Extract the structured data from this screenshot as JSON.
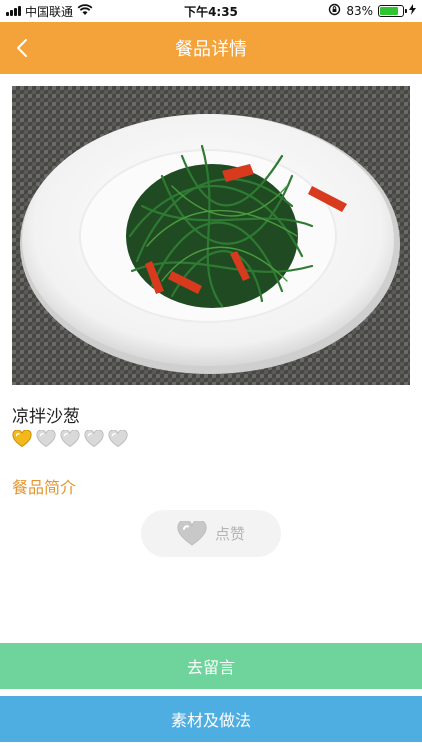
{
  "status_bar": {
    "carrier": "中国联通",
    "time": "下午4:35",
    "battery_percent": "83%",
    "battery_level": 0.83,
    "icons": [
      "signal-icon",
      "wifi-icon",
      "orientation-lock-icon",
      "battery-icon",
      "charging-icon"
    ]
  },
  "nav": {
    "title": "餐品详情",
    "back_icon": "chevron-left-icon"
  },
  "dish": {
    "name": "凉拌沙葱",
    "rating": 1,
    "rating_max": 5,
    "image_desc": "salad-plate-photo"
  },
  "intro": {
    "title": "餐品简介"
  },
  "like": {
    "label": "点赞",
    "icon": "heart-icon"
  },
  "actions": {
    "comment_label": "去留言",
    "recipe_label": "素材及做法"
  },
  "colors": {
    "nav_bg": "#f4a23a",
    "section_title": "#e4962e",
    "comment_btn": "#6ed49c",
    "recipe_btn": "#4eaee2",
    "heart_active": "#f2b81c",
    "heart_inactive": "#d9d9d9"
  }
}
